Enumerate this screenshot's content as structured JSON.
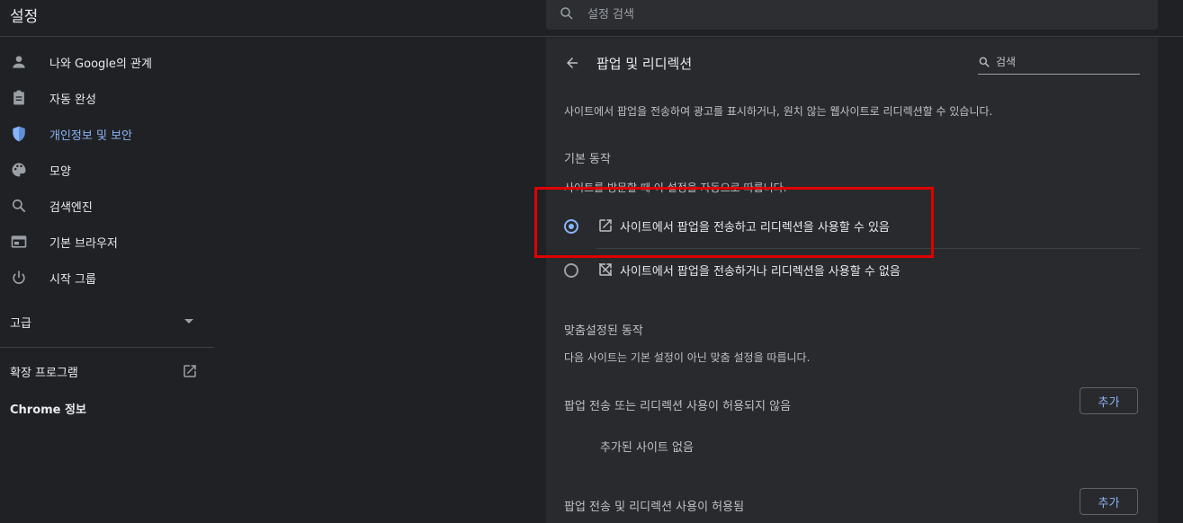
{
  "app": {
    "title": "설정"
  },
  "search": {
    "placeholder": "설정 검색"
  },
  "sidebar": {
    "items": [
      {
        "label": "나와 Google의 관계",
        "icon": "person-icon"
      },
      {
        "label": "자동 완성",
        "icon": "clipboard-icon"
      },
      {
        "label": "개인정보 및 보안",
        "icon": "shield-icon",
        "active": true
      },
      {
        "label": "모양",
        "icon": "palette-icon"
      },
      {
        "label": "검색엔진",
        "icon": "search-icon"
      },
      {
        "label": "기본 브라우저",
        "icon": "browser-icon"
      },
      {
        "label": "시작 그룹",
        "icon": "power-icon"
      }
    ],
    "advanced": "고급",
    "extensions": "확장 프로그램",
    "about": "Chrome 정보"
  },
  "content": {
    "title": "팝업 및 리디렉션",
    "search_placeholder": "검색",
    "description": "사이트에서 팝업을 전송하여 광고를 표시하거나, 원치 않는 웹사이트로 리디렉션할 수 있습니다.",
    "default_behavior": {
      "title": "기본 동작",
      "subtitle": "사이트를 방문할 때 이 설정을 자동으로 따릅니다.",
      "options": [
        {
          "label": "사이트에서 팝업을 전송하고 리디렉션을 사용할 수 있음",
          "icon": "open-in-new-icon",
          "selected": true
        },
        {
          "label": "사이트에서 팝업을 전송하거나 리디렉션을 사용할 수 없음",
          "icon": "open-in-new-off-icon",
          "selected": false
        }
      ]
    },
    "custom_behavior": {
      "title": "맞춤설정된 동작",
      "subtitle": "다음 사이트는 기본 설정이 아닌 맞춤 설정을 따릅니다.",
      "blocked_label": "팝업 전송 또는 리디렉션 사용이 허용되지 않음",
      "allowed_label": "팝업 전송 및 리디렉션 사용이 허용됨",
      "add_button": "추가",
      "empty_text": "추가된 사이트 없음"
    }
  },
  "colors": {
    "accent": "#8ab4f8",
    "highlight": "#e00000"
  }
}
